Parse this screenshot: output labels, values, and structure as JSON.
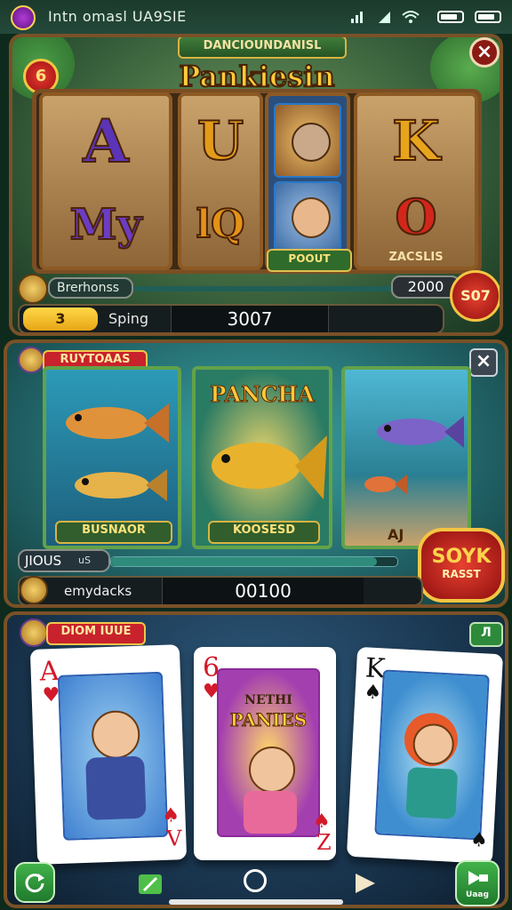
{
  "status_bar": {
    "title": "Intn omasl  UA9SIE"
  },
  "slot_panel": {
    "top_banner": "DANCIOUNDANISL",
    "game_title": "Pankiesin",
    "level_badge": "6",
    "close_label": "×",
    "reels": [
      {
        "top": "A",
        "bottom": "My"
      },
      {
        "top": "U",
        "bottom": "lQ"
      },
      {
        "top": "",
        "bottom": "",
        "caption": "POOUT"
      },
      {
        "top": "K",
        "bottom": "O",
        "caption": "ZACSLIS"
      }
    ],
    "info_label": "Brerhonss",
    "info_value": "2000",
    "win_badge": "S07",
    "bet_value": "3",
    "spin_label": "Sping",
    "credit_value": "3007"
  },
  "fish_panel": {
    "banner": "RUYTOAAS",
    "close_label": "×",
    "cards": [
      {
        "caption": "BUSNAOR"
      },
      {
        "title": "PANCHA",
        "caption": "KOOSESD"
      },
      {
        "caption": "AJ"
      }
    ],
    "progress_label": "JIOUS",
    "progress_sub": "uS",
    "progress_fraction": 0.93,
    "bonus_badge": "SOYK",
    "bonus_sub": "RASST",
    "info_label": "emydacks",
    "credit_value": "00100"
  },
  "card_panel": {
    "banner": "DIOM IUUE",
    "small_button": "Л",
    "cards": [
      {
        "rank": "A",
        "rank_bottom": "V",
        "suit": "♥",
        "suit_bottom": "♠"
      },
      {
        "rank": "6",
        "rank_bottom": "Z",
        "suit": "♥",
        "suit_bottom": "♠",
        "title_line1": "NETHI",
        "title_line2": "PANIES"
      },
      {
        "rank": "K",
        "rank_bottom": "",
        "suit": "♠",
        "suit_bottom": "♠"
      }
    ]
  },
  "nav": {
    "right_button_label": "Uaag"
  },
  "colors": {
    "wood": "#7a5128",
    "gold": "#f2b630",
    "red_badge": "#c3141d",
    "banner_red": "#c8222d"
  }
}
